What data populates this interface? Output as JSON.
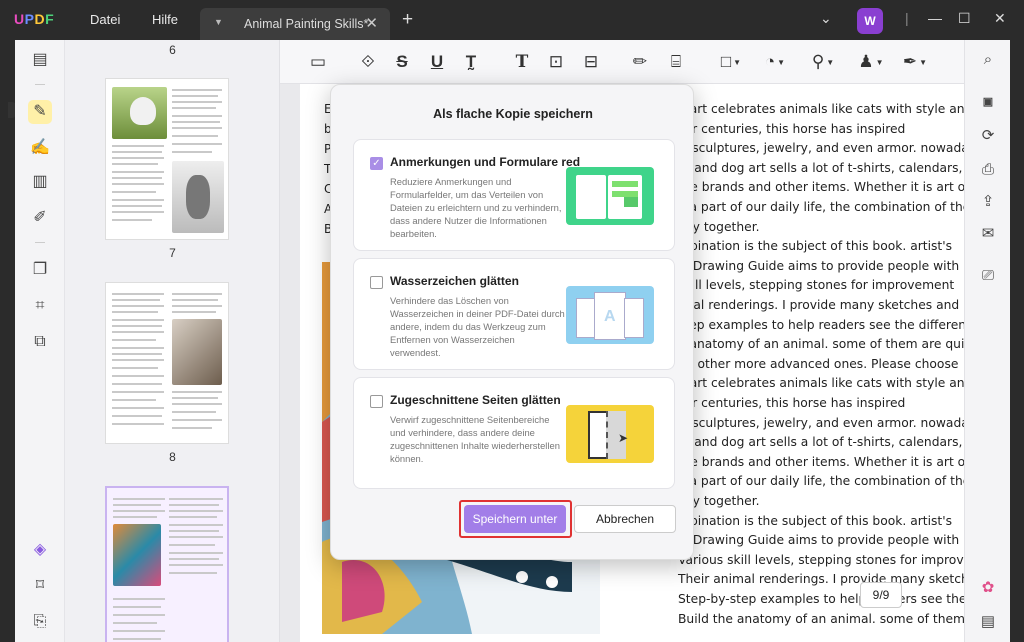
{
  "app": {
    "logo": "UPDF",
    "menu": [
      "Datei",
      "Hilfe"
    ],
    "tab_title": "Animal Painting Skills*",
    "user_initial": "W"
  },
  "thumbnails": {
    "labels": [
      "6",
      "7",
      "8"
    ]
  },
  "toolbar": {
    "icons": [
      "comment-icon",
      "highlight-icon",
      "strikethrough-icon",
      "underline-icon",
      "squiggly-icon",
      "text-icon",
      "textbox-icon",
      "text-callout-icon",
      "pencil-icon",
      "eraser-icon",
      "shape-icon",
      "sticker-icon",
      "pin-icon",
      "stamp-icon",
      "signature-icon"
    ]
  },
  "document": {
    "left_fragments": [
      "Eg",
      "be",
      "Pa",
      "Ti",
      "Ca",
      "An",
      "Be"
    ],
    "right_lines": [
      "n art celebrates animals like cats with style and style",
      "For centuries, this horse has inspired",
      "s, sculptures, jewelry, and even armor. nowadays",
      "at and dog art sells a lot of t-shirts, calendars, coffee",
      "ore brands and other items. Whether it is art or domest",
      "e a part of our daily life, the combination of the two",
      "ully together.",
      "mbination is the subject of this book. artist's",
      "al Drawing Guide aims to provide people with",
      "skill levels, stepping stones for improvement",
      "imal renderings. I provide many sketches and",
      "step examples to help readers see the different ways",
      "e anatomy of an animal. some of them are quite",
      "nd other more advanced ones. Please choose",
      "n art celebrates animals like cats with style and style",
      "For centuries, this horse has inspired",
      "s, sculptures, jewelry, and even armor. nowadays",
      "at and dog art sells a lot of t-shirts, calendars, coffee",
      "ore brands and other items. Whether it is art or domest",
      "e a part of our daily life, the combination of the two",
      "ully together.",
      "mbination is the subject of this book. artist's",
      "al Drawing Guide aims to provide people with",
      "Various skill levels, stepping stones for improvement",
      "Their animal renderings. I provide many sketches and",
      "Step-by-step examples to help readers see the different ways",
      "Build the anatomy of an animal. some of them are quite"
    ],
    "page_indicator": "9/9"
  },
  "dialog": {
    "title": "Als flache Kopie speichern",
    "options": [
      {
        "title": "Anmerkungen und Formulare red",
        "desc": "Reduziere Anmerkungen und Formularfelder, um das Verteilen von Dateien zu erleichtern und zu verhindern, dass andere Nutzer die Informationen bearbeiten.",
        "checked": true
      },
      {
        "title": "Wasserzeichen glätten",
        "desc": "Verhindere das Löschen von Wasserzeichen in deiner PDF-Datei durch andere, indem du das Werkzeug zum Entfernen von Wasserzeichen verwendest.",
        "checked": false
      },
      {
        "title": "Zugeschnittene Seiten glätten",
        "desc": "Verwirf zugeschnittene Seitenbereiche und verhindere, dass andere deine zugeschnittenen Inhalte wiederherstellen können.",
        "checked": false
      }
    ],
    "save_label": "Speichern unter",
    "cancel_label": "Abbrechen"
  },
  "colors": {
    "accent": "#a27ee8",
    "highlight_border": "#e03232",
    "logo_u": "#e94cc0",
    "logo_p": "#6b8cff",
    "logo_d": "#ffc83a",
    "logo_f": "#4cd27a"
  }
}
